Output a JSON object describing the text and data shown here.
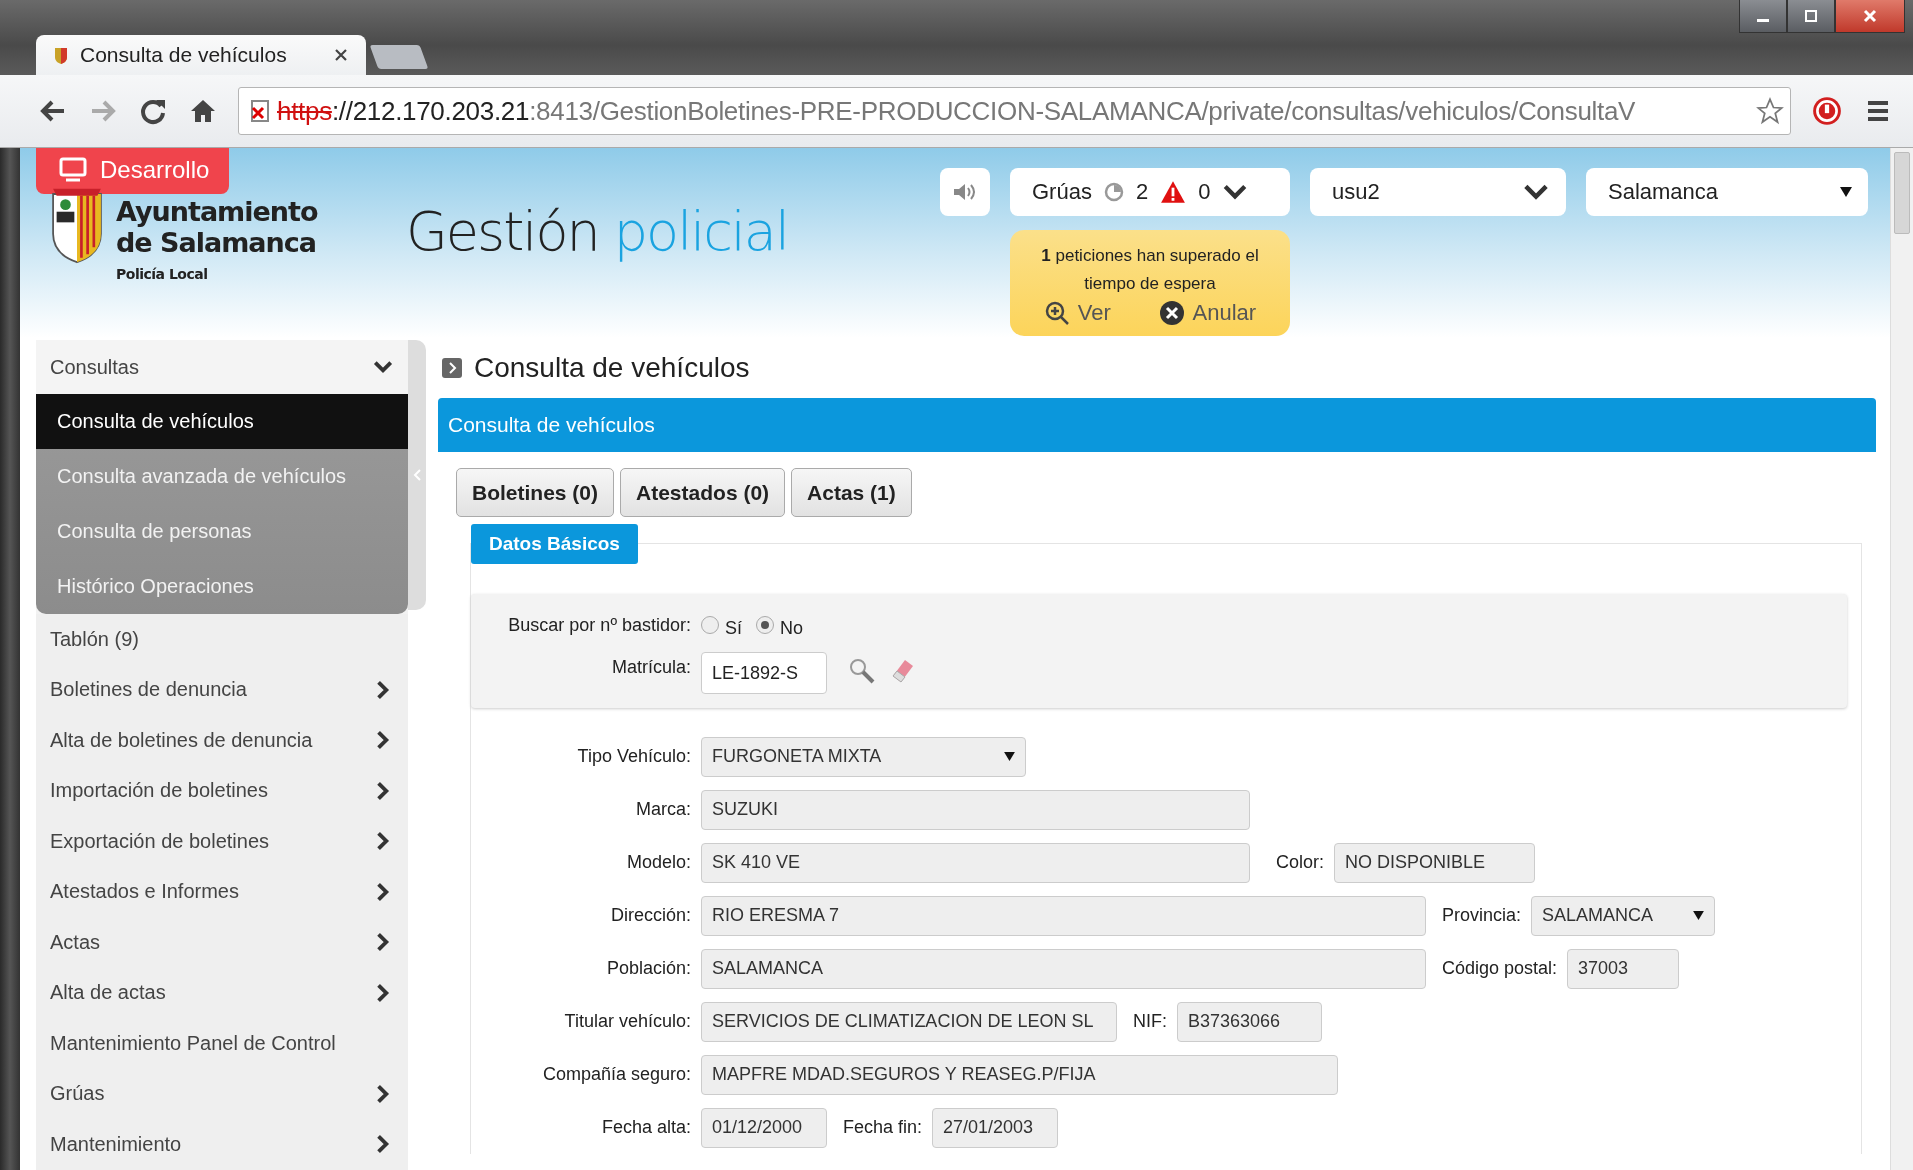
{
  "browser": {
    "tab_title": "Consulta de vehículos",
    "url": {
      "secure": false,
      "scheme": "https",
      "host": "://212.170.203.21",
      "rest": ":8413/GestionBoletines-PRE-PRODUCCION-SALAMANCA/private/consultas/vehiculos/ConsultaV"
    }
  },
  "header": {
    "env_badge": "Desarrollo",
    "logo_lines": [
      "Ayuntamiento",
      "de Salamanca"
    ],
    "logo_subtitle": "Policía Local",
    "app_title": "Gestión",
    "app_title_accent": "policial",
    "tows": {
      "label": "Grúas",
      "pending": "2",
      "alerts": "0"
    },
    "user": "usu2",
    "city": "Salamanca",
    "alert": {
      "message": "**1** peticiones han superado el tiempo de espera",
      "actions": [
        {
          "label": "Ver",
          "kind": "view"
        },
        {
          "label": "Anular",
          "kind": "cancel"
        }
      ]
    }
  },
  "sidebar": {
    "items": [
      {
        "label": "Consultas",
        "kind": "group",
        "expanded": true,
        "children": [
          {
            "label": "Consulta de vehículos",
            "selected": true
          },
          {
            "label": "Consulta avanzada de vehículos",
            "selected": false
          },
          {
            "label": "Consulta de personas",
            "selected": false
          },
          {
            "label": "Histórico Operaciones",
            "selected": false
          }
        ]
      },
      {
        "label": "Tablón (9)",
        "kind": "link"
      },
      {
        "label": "Boletines de denuncia",
        "kind": "submenu"
      },
      {
        "label": "Alta de boletines de denuncia",
        "kind": "submenu"
      },
      {
        "label": "Importación de boletines",
        "kind": "submenu"
      },
      {
        "label": "Exportación de boletines",
        "kind": "submenu"
      },
      {
        "label": "Atestados e Informes",
        "kind": "submenu"
      },
      {
        "label": "Actas",
        "kind": "submenu"
      },
      {
        "label": "Alta de actas",
        "kind": "submenu"
      },
      {
        "label": "Mantenimiento Panel de Control",
        "kind": "link"
      },
      {
        "label": "Grúas",
        "kind": "submenu"
      },
      {
        "label": "Mantenimiento",
        "kind": "submenu"
      }
    ]
  },
  "main": {
    "page_title": "Consulta de vehículos",
    "panel_title": "Consulta de vehículos",
    "tabs": [
      "Boletines (0)",
      "Atestados (0)",
      "Actas (1)"
    ],
    "section_tab": "Datos Básicos",
    "search": {
      "label": "Buscar por nº bastidor:",
      "options": [
        {
          "label": "Sí",
          "selected": false
        },
        {
          "label": "No",
          "selected": true
        }
      ],
      "plate_label": "Matrícula:",
      "plate_value": "LE-1892-S"
    },
    "rows": [
      {
        "fields": [
          {
            "label": "Tipo Vehículo:",
            "value": "FURGONETA MIXTA",
            "kind": "select"
          }
        ]
      },
      {
        "fields": [
          {
            "label": "Marca:",
            "value": "SUZUKI",
            "kind": "text"
          }
        ]
      },
      {
        "fields": [
          {
            "label": "Modelo:",
            "value": "SK 410 VE",
            "kind": "text"
          },
          {
            "label": "Color:",
            "value": "NO DISPONIBLE",
            "kind": "text"
          }
        ]
      },
      {
        "fields": [
          {
            "label": "Dirección:",
            "value": "RIO ERESMA 7",
            "kind": "text"
          },
          {
            "label": "Provincia:",
            "value": "SALAMANCA",
            "kind": "select"
          }
        ]
      },
      {
        "fields": [
          {
            "label": "Población:",
            "value": "SALAMANCA",
            "kind": "text"
          },
          {
            "label": "Código postal:",
            "value": "37003",
            "kind": "text"
          }
        ]
      },
      {
        "fields": [
          {
            "label": "Titular vehículo:",
            "value": "SERVICIOS DE CLIMATIZACION DE LEON SL",
            "kind": "text"
          },
          {
            "label": "NIF:",
            "value": "B37363066",
            "kind": "text"
          }
        ]
      },
      {
        "fields": [
          {
            "label": "Compañía seguro:",
            "value": "MAPFRE MDAD.SEGUROS Y REASEG.P/FIJA",
            "kind": "text"
          }
        ]
      },
      {
        "fields": [
          {
            "label": "Fecha alta:",
            "value": "01/12/2000",
            "kind": "text"
          },
          {
            "label": "Fecha fin:",
            "value": "27/01/2003",
            "kind": "text"
          }
        ]
      }
    ]
  }
}
